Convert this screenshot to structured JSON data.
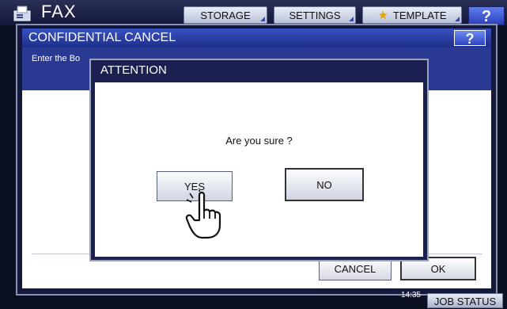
{
  "header": {
    "app_title": "FAX",
    "tabs": [
      {
        "label": "STORAGE"
      },
      {
        "label": "SETTINGS"
      },
      {
        "label": "TEMPLATE",
        "icon": "star-icon"
      }
    ],
    "help_label": "?"
  },
  "dialog": {
    "title": "CONFIDENTIAL CANCEL",
    "help_label": "?",
    "instruction": "Enter the Bo",
    "cancel_label": "CANCEL",
    "ok_label": "OK"
  },
  "attention": {
    "title": "ATTENTION",
    "message": "Are you sure ?",
    "yes_label": "YES",
    "no_label": "NO"
  },
  "status": {
    "time": "14:35",
    "job_status_label": "JOB STATUS"
  }
}
